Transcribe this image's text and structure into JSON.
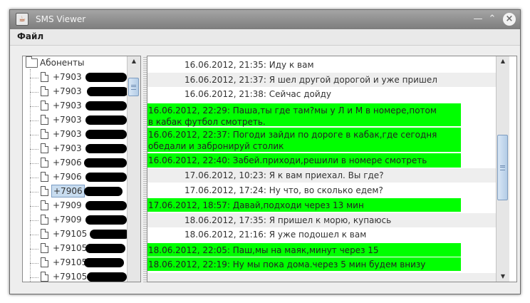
{
  "window": {
    "title": "SMS Viewer",
    "app_icon_glyph": "☕",
    "minimize_glyph": "—",
    "maximize_glyph": "⌃",
    "close_glyph": "×"
  },
  "menu": {
    "file": "Файл"
  },
  "tree": {
    "root_label": "Абоненты",
    "items": [
      {
        "label": "+7903",
        "redacted": true
      },
      {
        "label": "+7903",
        "redacted": true
      },
      {
        "label": "+7903",
        "redacted": true
      },
      {
        "label": "+7903",
        "redacted": true
      },
      {
        "label": "+7903",
        "redacted": true
      },
      {
        "label": "+7903",
        "redacted": true
      },
      {
        "label": "+7906",
        "redacted": true
      },
      {
        "label": "+7906",
        "redacted": true
      },
      {
        "label": "+7906",
        "redacted": true,
        "selected": true
      },
      {
        "label": "+7909",
        "redacted": true
      },
      {
        "label": "+7909",
        "redacted": true
      },
      {
        "label": "+79105",
        "redacted": true
      },
      {
        "label": "+79105",
        "redacted": true
      },
      {
        "label": "+79105",
        "redacted": true
      },
      {
        "label": "+79105",
        "redacted": true
      }
    ]
  },
  "messages": [
    {
      "text": "16.06.2012, 21:35: Иду к вам",
      "incoming": false
    },
    {
      "text": "16.06.2012, 21:37: Я шел другой дорогой и уже пришел",
      "incoming": false
    },
    {
      "text": "16.06.2012, 21:38: Сейчас дойду",
      "incoming": false
    },
    {
      "text": "16.06.2012, 22:29: Паша,ты где там?мы у Л и М в номере,потом в кабак футбол смотреть.",
      "incoming": true
    },
    {
      "text": "16.06.2012, 22:37: Погоди зайди по дороге в кабак,где сегодня обедали и забронируй столик",
      "incoming": true
    },
    {
      "text": "16.06.2012, 22:40: Забей.приходи,решили в номере смотреть",
      "incoming": true
    },
    {
      "text": "17.06.2012, 10:23: Я к вам приехал. Вы где?",
      "incoming": false
    },
    {
      "text": "17.06.2012, 17:24: Ну что, во сколько едем?",
      "incoming": false
    },
    {
      "text": "17.06.2012, 18:57: Давай,подходи через 13 мин",
      "incoming": true
    },
    {
      "text": "18.06.2012, 17:35: Я пришел к морю, купаюсь",
      "incoming": false
    },
    {
      "text": "18.06.2012, 21:16: Я уже подошел к вам",
      "incoming": false
    },
    {
      "text": "18.06.2012, 22:05: Паш,мы на маяк,минут через 15",
      "incoming": true
    },
    {
      "text": "18.06.2012, 22:19: Ну мы пока дома.через 5 мин будем внизу",
      "incoming": true
    },
    {
      "text": "",
      "incoming": false
    }
  ],
  "scroll": {
    "up_glyph": "▲",
    "down_glyph": "▼"
  },
  "colors": {
    "incoming_bg": "#00ff00",
    "stripe_bg": "#eeeeee",
    "selection_bg": "#c8dcef"
  }
}
